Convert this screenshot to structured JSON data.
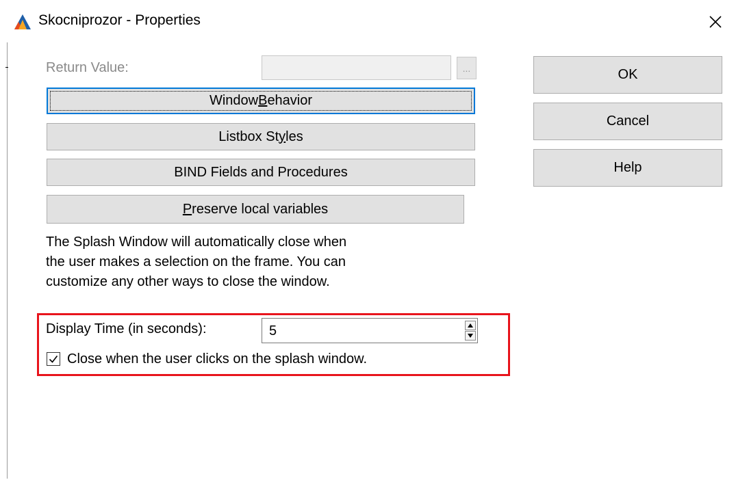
{
  "window": {
    "title": "Skocniprozor - Properties",
    "icon": "app-triangle-icon",
    "close_icon": "close-icon"
  },
  "return_value": {
    "label": "Return Value:",
    "value": "",
    "browse_label": "..."
  },
  "buttons": {
    "window_behavior": {
      "pre": "Window ",
      "mnemonic": "B",
      "post": "ehavior"
    },
    "listbox_styles": {
      "pre": "Listbox St",
      "mnemonic": "y",
      "post": "les"
    },
    "bind_fields": {
      "label": "BIND Fields and Procedures"
    },
    "preserve_locals": {
      "pre": "",
      "mnemonic": "P",
      "post": "reserve local variables"
    },
    "ok": "OK",
    "cancel": "Cancel",
    "help": "Help"
  },
  "description": {
    "line1": "The Splash Window will automatically close when",
    "line2": "the user makes a selection on the frame. You can",
    "line3": "customize any other ways to close the window."
  },
  "display_time": {
    "label": "Display Time (in seconds):",
    "value": "5"
  },
  "close_on_click": {
    "label": "Close when the user clicks on the splash window.",
    "checked": true
  },
  "colors": {
    "highlight": "#e8141c",
    "focus": "#0078d7",
    "button_face": "#e1e1e1"
  }
}
